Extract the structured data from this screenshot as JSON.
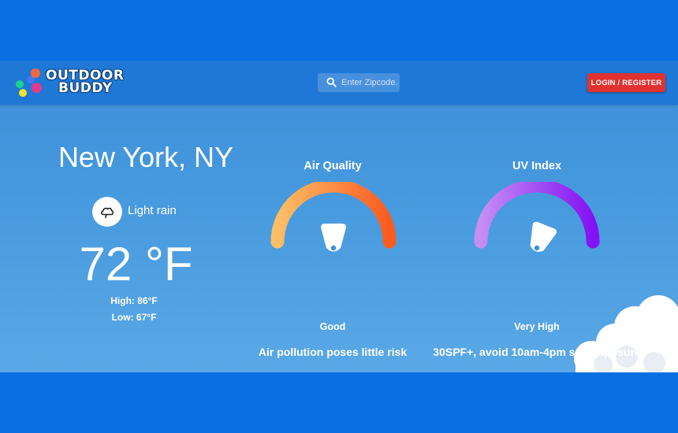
{
  "header": {
    "logo_line1": "OUTDOOR",
    "logo_line2": "BUDDY",
    "search_placeholder": "Enter Zipcode..",
    "login_label": "LOGIN / REGISTER"
  },
  "weather": {
    "city": "New York, NY",
    "condition": "Light rain",
    "condition_icon": "rain-cloud-icon",
    "temperature": "72 °F",
    "high": "High: 86°F",
    "low": "Low: 67°F"
  },
  "air_quality": {
    "title": "Air Quality",
    "level": "Good",
    "level_fraction": 0.5,
    "description": "Air pollution poses little risk"
  },
  "uv_index": {
    "title": "UV Index",
    "level": "Very High",
    "level_fraction": 0.62,
    "description": "30SPF+, avoid 10am-4pm sun exposure"
  },
  "colors": {
    "navbar": "#1f78d6",
    "login_button": "#e03231",
    "aq_gradient": [
      "#fdbf66",
      "#fc5b20"
    ],
    "uv_gradient": [
      "#c58ef5",
      "#8312f2"
    ]
  }
}
